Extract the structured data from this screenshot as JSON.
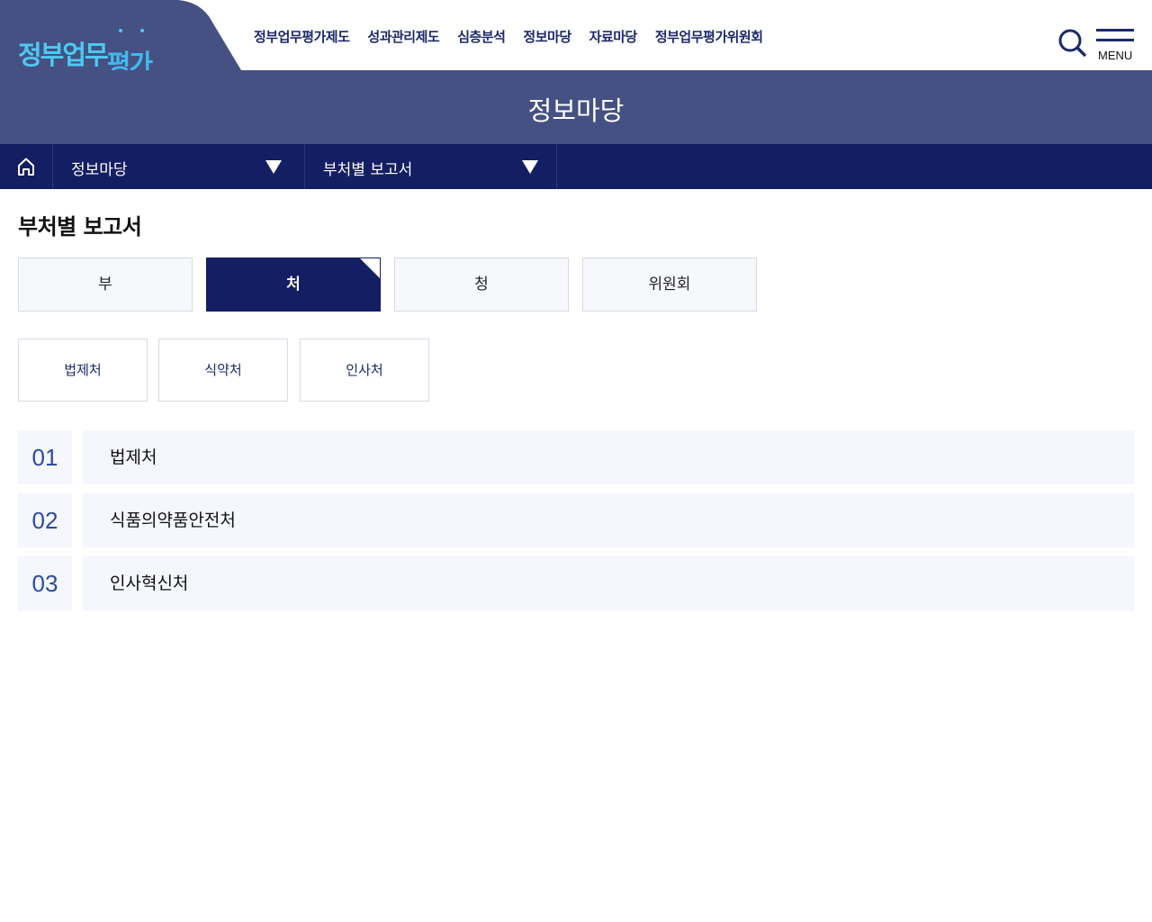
{
  "header": {
    "logo": {
      "part1": "정부업무",
      "part2": "평가"
    },
    "nav": [
      {
        "label": "정부업무평가제도"
      },
      {
        "label": "성과관리제도"
      },
      {
        "label": "심층분석"
      },
      {
        "label": "정보마당"
      },
      {
        "label": "자료마당"
      },
      {
        "label": "정부업무평가위원회"
      }
    ],
    "search_icon": "search-icon",
    "menu_label": "MENU"
  },
  "title_band": {
    "title": "정보마당"
  },
  "location": {
    "home_icon": "home-icon",
    "level1": "정보마당",
    "level2": "부처별 보고서"
  },
  "page": {
    "title": "부처별 보고서",
    "tabs": [
      {
        "label": "부",
        "active": false
      },
      {
        "label": "처",
        "active": true
      },
      {
        "label": "청",
        "active": false
      },
      {
        "label": "위원회",
        "active": false
      }
    ],
    "subtabs": [
      {
        "label": "법제처"
      },
      {
        "label": "식약처"
      },
      {
        "label": "인사처"
      }
    ],
    "list": [
      {
        "num": "01",
        "name": "법제처"
      },
      {
        "num": "02",
        "name": "식품의약품안전처"
      },
      {
        "num": "03",
        "name": "인사혁신처"
      }
    ]
  },
  "colors": {
    "brand_navy": "#141e62",
    "title_band": "#455183",
    "logo_blue": "#4ec9f0",
    "number_blue": "#2c4aa0",
    "row_bg": "#f5f7fc"
  }
}
